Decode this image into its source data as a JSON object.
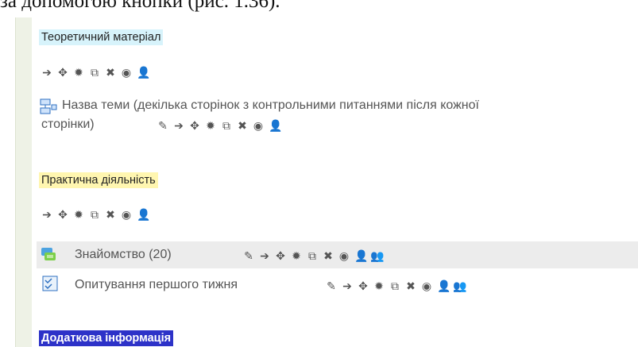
{
  "caption": "за допомогою кнопки (рис. 1.36).",
  "sections": {
    "theory": "Теоретичний матеріал",
    "practice": "Практична діяльність",
    "additional": "Додаткова інформація"
  },
  "activities": {
    "lesson_title_line1": "Назва теми (декілька сторінок з контрольними питаннями після кожної",
    "lesson_title_line2": "сторінки)",
    "forum_title": "Знайомство (20)",
    "quiz_title": "Опитування першого тижня"
  },
  "toolbar_icons": [
    "move-right-icon",
    "move-icon",
    "settings-icon",
    "duplicate-icon",
    "delete-icon",
    "visibility-icon",
    "assign-roles-icon"
  ],
  "colors": {
    "theory_highlight": "#d7f3fb",
    "practice_highlight": "#fff6b0",
    "additional_highlight": "#2d32c8"
  }
}
